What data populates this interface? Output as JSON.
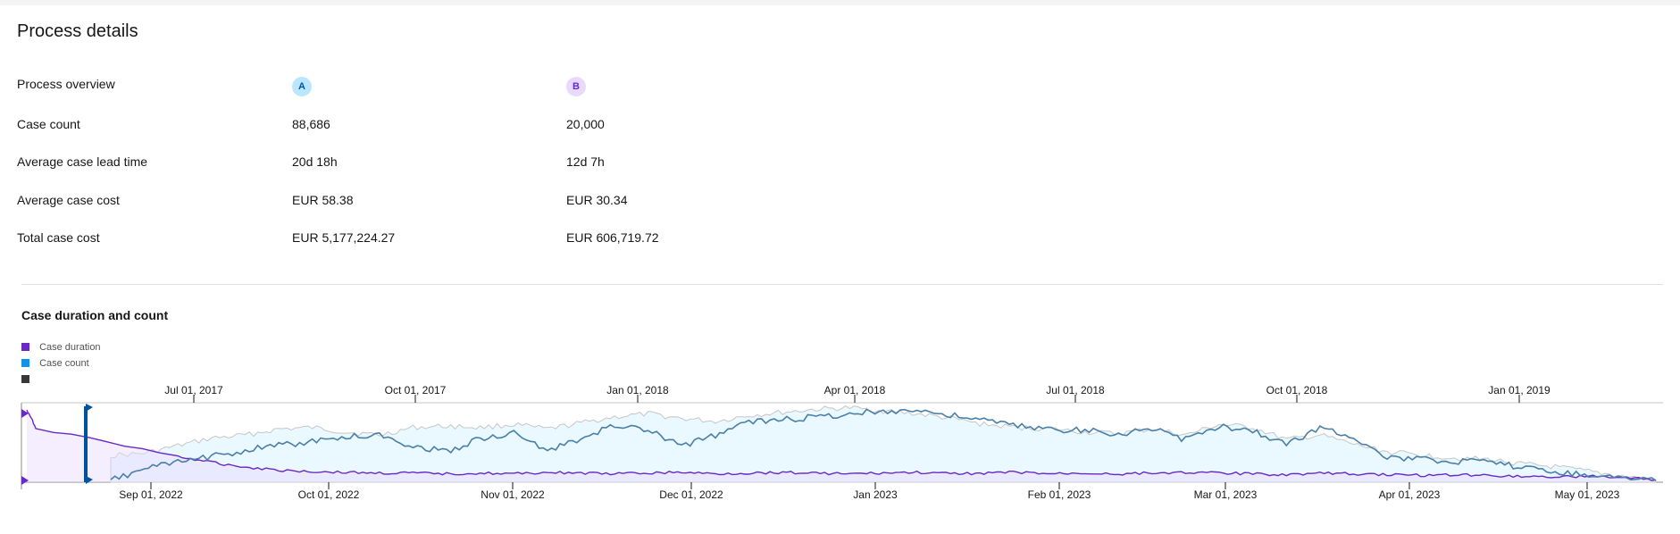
{
  "page": {
    "title": "Process details"
  },
  "comparison": {
    "badge_a": "A",
    "badge_b": "B",
    "rows": [
      {
        "label": "Process overview",
        "a": "",
        "b": ""
      },
      {
        "label": "Case count",
        "a": "88,686",
        "b": "20,000"
      },
      {
        "label": "Average case lead time",
        "a": "20d 18h",
        "b": "12d 7h"
      },
      {
        "label": "Average case cost",
        "a": "EUR 58.38",
        "b": "EUR 30.34"
      },
      {
        "label": "Total case cost",
        "a": "EUR 5,177,224.27",
        "b": "EUR 606,719.72"
      }
    ]
  },
  "chart_data": {
    "type": "area",
    "title": "Case duration and count",
    "legend": [
      {
        "name": "Case duration",
        "color": "#6929c4"
      },
      {
        "name": "Case count",
        "color": "#1192e8"
      },
      {
        "name": "",
        "color": "#393939"
      }
    ],
    "top_axis_ticks": [
      "Jul 01, 2017",
      "Oct 01, 2017",
      "Jan 01, 2018",
      "Apr 01, 2018",
      "Jul 01, 2018",
      "Oct 01, 2018",
      "Jan 01, 2019"
    ],
    "bottom_axis_ticks": [
      "Sep 01, 2022",
      "Oct 01, 2022",
      "Nov 01, 2022",
      "Dec 01, 2022",
      "Jan 2023",
      "Feb 01, 2023",
      "Mar 01, 2023",
      "Apr 01, 2023",
      "May 01, 2023"
    ],
    "series": [
      {
        "name": "Case count",
        "color": "#1192e8",
        "values": [
          0.02,
          0.18,
          0.26,
          0.34,
          0.42,
          0.49,
          0.53,
          0.6,
          0.62,
          0.48,
          0.4,
          0.58,
          0.64,
          0.42,
          0.56,
          0.76,
          0.68,
          0.48,
          0.62,
          0.8,
          0.82,
          0.86,
          0.9,
          0.94,
          0.95,
          0.88,
          0.82,
          0.74,
          0.7,
          0.68,
          0.64,
          0.7,
          0.56,
          0.74,
          0.68,
          0.5,
          0.72,
          0.6,
          0.32,
          0.3,
          0.28,
          0.26,
          0.2,
          0.14,
          0.1,
          0.06,
          0.02
        ]
      },
      {
        "name": "Case duration",
        "color": "#6929c4",
        "values": [
          0.95,
          0.72,
          0.34,
          0.26,
          0.2,
          0.16,
          0.14,
          0.13,
          0.12,
          0.12,
          0.11,
          0.12,
          0.11,
          0.13,
          0.12,
          0.11,
          0.12,
          0.13,
          0.11,
          0.12,
          0.13,
          0.12,
          0.11,
          0.12,
          0.13,
          0.11,
          0.12,
          0.13,
          0.11,
          0.12,
          0.11,
          0.12,
          0.13,
          0.12,
          0.11,
          0.1,
          0.12,
          0.11,
          0.1,
          0.09,
          0.1,
          0.09,
          0.08,
          0.07,
          0.08,
          0.06,
          0.03
        ]
      },
      {
        "name": "",
        "color": "#393939",
        "values": [
          0.35,
          0.38,
          0.48,
          0.58,
          0.62,
          0.7,
          0.72,
          0.66,
          0.62,
          0.72,
          0.74,
          0.72,
          0.76,
          0.7,
          0.78,
          0.86,
          0.9,
          0.84,
          0.8,
          0.88,
          0.92,
          0.96,
          0.98,
          0.94,
          0.9,
          0.84,
          0.76,
          0.72,
          0.7,
          0.66,
          0.64,
          0.7,
          0.62,
          0.76,
          0.72,
          0.56,
          0.62,
          0.5,
          0.4,
          0.36,
          0.32,
          0.3,
          0.24,
          0.2,
          0.14,
          0.08,
          0.02
        ]
      }
    ],
    "ylim": [
      0,
      1
    ]
  }
}
